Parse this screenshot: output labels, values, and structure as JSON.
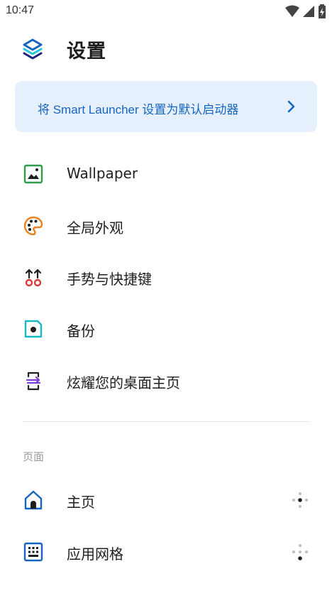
{
  "status": {
    "time": "10:47",
    "icons": [
      "wifi-icon",
      "cell-signal-icon",
      "battery-icon"
    ]
  },
  "header": {
    "title": "设置",
    "logo_icon": "smart-launcher-logo"
  },
  "banner": {
    "text": "将 Smart Launcher 设置为默认启动器",
    "icon": "chevron-right-icon",
    "color": "#1565c0",
    "background": "#e6f0fd"
  },
  "menu": {
    "items": [
      {
        "label": "Wallpaper",
        "icon": "wallpaper-icon",
        "color": "#2e9e4a"
      },
      {
        "label": "全局外观",
        "icon": "palette-icon",
        "color": "#e8821e"
      },
      {
        "label": "手势与快捷键",
        "icon": "gestures-icon",
        "color": "#d83a3a"
      },
      {
        "label": "备份",
        "icon": "backup-icon",
        "color": "#1bb8c4"
      },
      {
        "label": "炫耀您的桌面主页",
        "icon": "share-screen-icon",
        "color": "#7b3fd4"
      }
    ]
  },
  "pages": {
    "section_title": "页面",
    "items": [
      {
        "label": "主页",
        "icon": "home-icon",
        "color": "#1565c0"
      },
      {
        "label": "应用网格",
        "icon": "app-grid-icon",
        "color": "#1565c0"
      }
    ],
    "handle_icon": "drag-handle-icon"
  }
}
